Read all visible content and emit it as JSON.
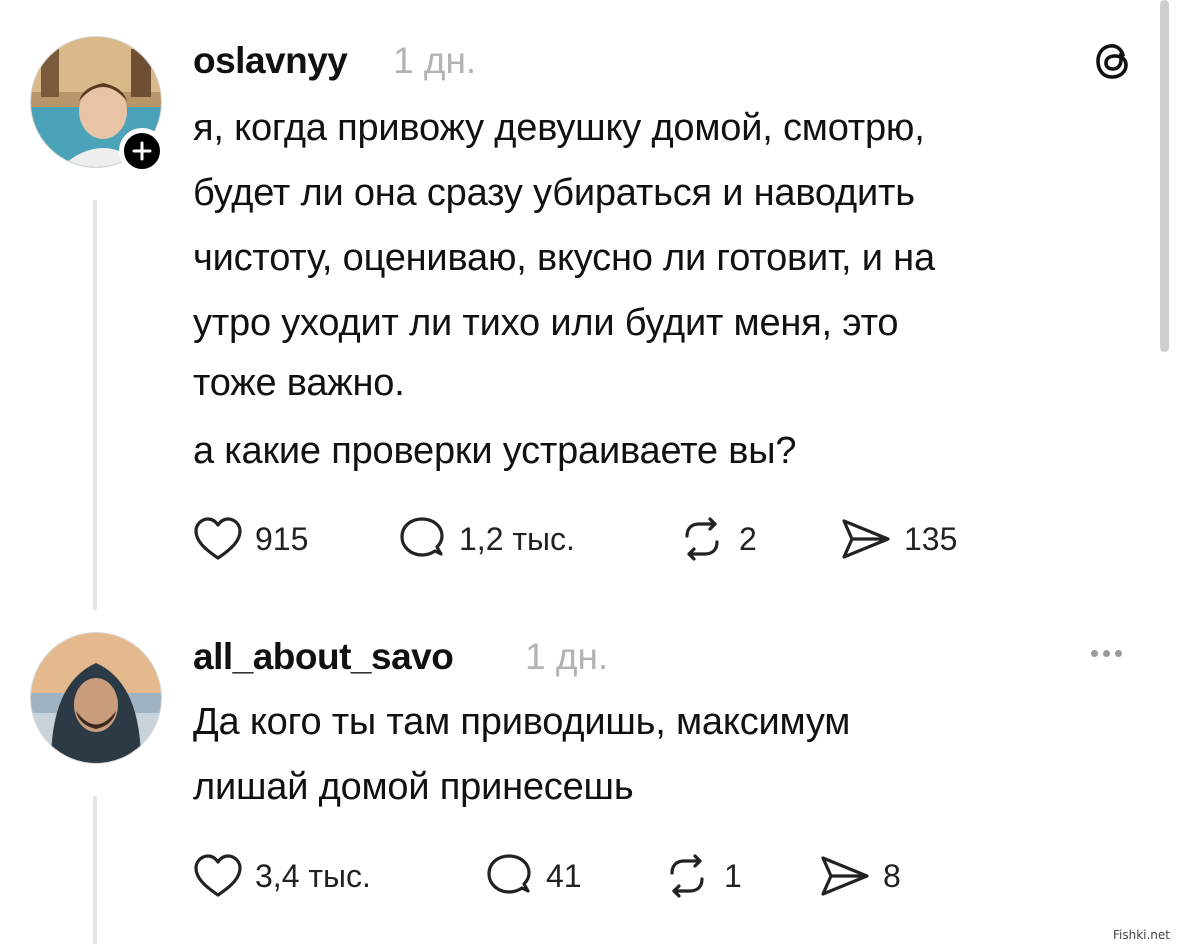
{
  "posts": [
    {
      "username": "oslavnyy",
      "time": "1 дн.",
      "text_lines": [
        "я, когда привожу девушку домой, смотрю,",
        "будет ли она сразу убираться и наводить",
        "чистоту, оцениваю, вкусно ли готовит, и на",
        "утро уходит ли тихо или будит меня, это",
        "тоже важно.",
        "а какие проверки устраиваете вы?"
      ],
      "likes": "915",
      "replies": "1,2 тыс.",
      "reposts": "2",
      "shares": "135",
      "top_right_icon": "threads-logo-icon"
    },
    {
      "username": "all_about_savo",
      "time": "1 дн.",
      "text_lines": [
        "Да кого ты там приводишь, максимум",
        "лишай домой принесешь"
      ],
      "likes": "3,4 тыс.",
      "replies": "41",
      "reposts": "1",
      "shares": "8",
      "top_right_icon": "more-options-icon"
    }
  ],
  "watermark": "Fishki.net",
  "icons": {
    "like": "heart-icon",
    "reply": "comment-bubble-icon",
    "repost": "repost-arrows-icon",
    "share": "send-icon",
    "follow": "plus-icon"
  }
}
